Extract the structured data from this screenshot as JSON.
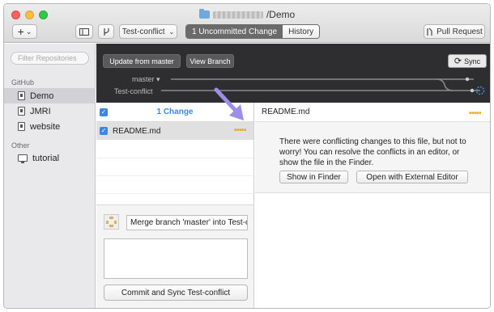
{
  "window": {
    "title": "/Demo",
    "folder_icon": "folder-icon"
  },
  "toolbar": {
    "add_label": "+",
    "add_chevron": "⌄",
    "sidebar_toggle_icon": "sidebar-icon",
    "branch_icon": "branch-icon",
    "branch_selector": "Test-conflict",
    "branch_chevron": "⌄",
    "tab_changes": "1 Uncommitted Change",
    "tab_history": "History",
    "pull_request": "Pull Request"
  },
  "sidebar": {
    "filter_placeholder": "Filter Repositories",
    "section_github": "GitHub",
    "github_items": [
      {
        "label": "Demo",
        "icon": "repo-icon",
        "selected": true
      },
      {
        "label": "JMRI",
        "icon": "repo-icon",
        "selected": false
      },
      {
        "label": "website",
        "icon": "repo-icon",
        "selected": false
      }
    ],
    "section_other": "Other",
    "other_items": [
      {
        "label": "tutorial",
        "icon": "monitor-icon",
        "selected": false
      }
    ]
  },
  "branchbar": {
    "update_button": "Update from master",
    "view_branch_button": "View Branch",
    "sync_button": "Sync",
    "master_label": "master ▾",
    "test_label": "Test-conflict"
  },
  "changes": {
    "header": "1 Change",
    "files": [
      {
        "name": "README.md",
        "checked": true
      }
    ],
    "commit_summary": "Merge branch 'master' into Test-conflict",
    "commit_button": "Commit and Sync Test-conflict"
  },
  "diff": {
    "file_name": "README.md",
    "message": "There were conflicting changes to this file, but not to worry! You can resolve the conflicts in an editor, or show the file in the Finder.",
    "show_finder": "Show in Finder",
    "open_editor": "Open with External Editor"
  },
  "colors": {
    "accent": "#3b87e8",
    "dark_bar": "#2e2e30",
    "conflict_marker": "#e8a40c",
    "arrow": "#9d8ee8"
  }
}
